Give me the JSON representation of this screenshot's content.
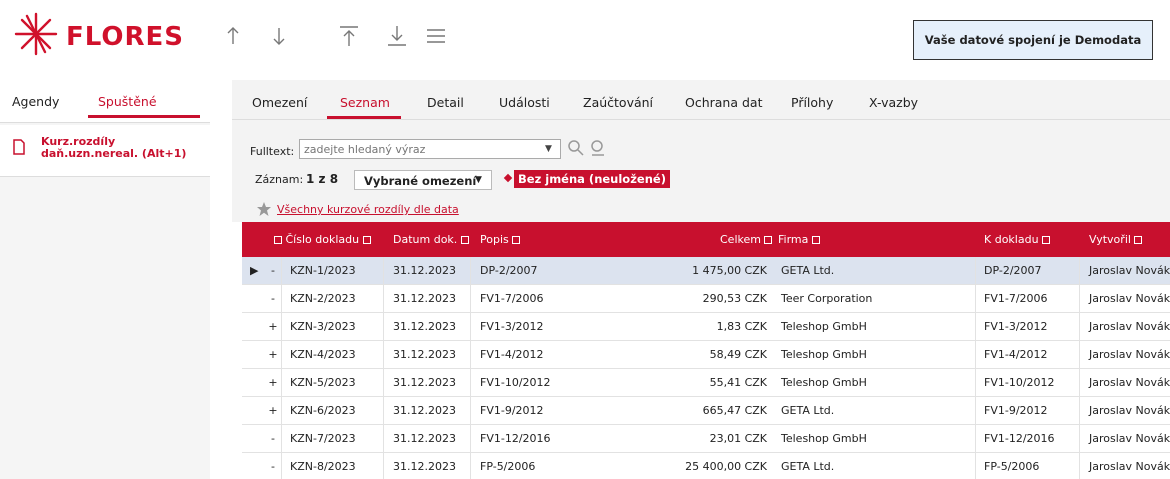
{
  "app": {
    "logo_text": "FLORES",
    "connection_label": "Vaše datové spojení je Demodata",
    "colors": {
      "accent": "#c8102e",
      "selected_row": "#dce3ef",
      "connection_bg": "#e6f0fb"
    },
    "toolbar_icons": [
      "arrow-up-icon",
      "arrow-down-icon",
      "arrow-to-top-icon",
      "arrow-to-bottom-icon",
      "menu-icon"
    ]
  },
  "left_panel": {
    "tabs": [
      {
        "label": "Agendy",
        "active": false
      },
      {
        "label": "Spuštěné",
        "active": true
      }
    ],
    "running": {
      "line1": "Kurz.rozdíly",
      "line2": "daň.uzn.nereal. (Alt+1)"
    }
  },
  "main_tabs": [
    {
      "label": "Omezení",
      "active": false
    },
    {
      "label": "Seznam",
      "active": true
    },
    {
      "label": "Detail",
      "active": false
    },
    {
      "label": "Události",
      "active": false
    },
    {
      "label": "Zaúčtování",
      "active": false
    },
    {
      "label": "Ochrana dat",
      "active": false
    },
    {
      "label": "Přílohy",
      "active": false
    },
    {
      "label": "X-vazby",
      "active": false
    }
  ],
  "filter": {
    "fulltext_label": "Fulltext:",
    "fulltext_placeholder": "zadejte hledaný výraz",
    "record_label": "Záznam:",
    "record_value": "1 z 8",
    "restriction_select": "Vybrané omezení",
    "unnamed_badge": "Bez jména (neuložené)",
    "saved_filter_link": "Všechny kurzové rozdíly dle data"
  },
  "table": {
    "columns": [
      "Číslo dokladu",
      "Datum dok.",
      "Popis",
      "Celkem",
      "Firma",
      "K dokladu",
      "Vytvořil"
    ],
    "rows": [
      {
        "sign": "-",
        "num": "KZN-1/2023",
        "date": "31.12.2023",
        "popis": "DP-2/2007",
        "total": "1 475,00 CZK",
        "firm": "GETA Ltd.",
        "kdok": "DP-2/2007",
        "user": "Jaroslav Novák",
        "selected": true
      },
      {
        "sign": "-",
        "num": "KZN-2/2023",
        "date": "31.12.2023",
        "popis": "FV1-7/2006",
        "total": "290,53 CZK",
        "firm": "Teer Corporation",
        "kdok": "FV1-7/2006",
        "user": "Jaroslav Novák",
        "selected": false
      },
      {
        "sign": "+",
        "num": "KZN-3/2023",
        "date": "31.12.2023",
        "popis": "FV1-3/2012",
        "total": "1,83 CZK",
        "firm": "Teleshop GmbH",
        "kdok": "FV1-3/2012",
        "user": "Jaroslav Novák",
        "selected": false
      },
      {
        "sign": "+",
        "num": "KZN-4/2023",
        "date": "31.12.2023",
        "popis": "FV1-4/2012",
        "total": "58,49 CZK",
        "firm": "Teleshop GmbH",
        "kdok": "FV1-4/2012",
        "user": "Jaroslav Novák",
        "selected": false
      },
      {
        "sign": "+",
        "num": "KZN-5/2023",
        "date": "31.12.2023",
        "popis": "FV1-10/2012",
        "total": "55,41 CZK",
        "firm": "Teleshop GmbH",
        "kdok": "FV1-10/2012",
        "user": "Jaroslav Novák",
        "selected": false
      },
      {
        "sign": "+",
        "num": "KZN-6/2023",
        "date": "31.12.2023",
        "popis": "FV1-9/2012",
        "total": "665,47 CZK",
        "firm": "GETA Ltd.",
        "kdok": "FV1-9/2012",
        "user": "Jaroslav Novák",
        "selected": false
      },
      {
        "sign": "-",
        "num": "KZN-7/2023",
        "date": "31.12.2023",
        "popis": "FV1-12/2016",
        "total": "23,01 CZK",
        "firm": "Teleshop GmbH",
        "kdok": "FV1-12/2016",
        "user": "Jaroslav Novák",
        "selected": false
      },
      {
        "sign": "-",
        "num": "KZN-8/2023",
        "date": "31.12.2023",
        "popis": "FP-5/2006",
        "total": "25 400,00 CZK",
        "firm": "GETA Ltd.",
        "kdok": "FP-5/2006",
        "user": "Jaroslav Novák",
        "selected": false
      }
    ]
  }
}
